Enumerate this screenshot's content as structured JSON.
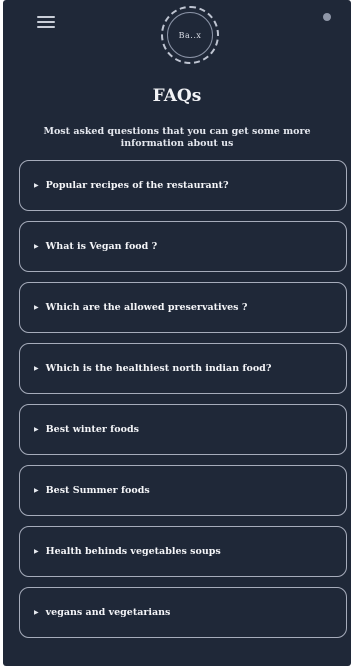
{
  "header": {
    "menu_icon": "hamburger-menu-icon",
    "logo_text": "Ba..x",
    "right_icon": "dot-icon"
  },
  "page": {
    "title": "FAQs",
    "subtitle": "Most asked questions that you can get some more information about us"
  },
  "faqs": [
    {
      "label": "Popular recipes of the restaurant?"
    },
    {
      "label": "What is Vegan food ?"
    },
    {
      "label": "Which are the allowed preservatives ?"
    },
    {
      "label": "Which is the healthiest north indian food?"
    },
    {
      "label": "Best winter foods"
    },
    {
      "label": "Best Summer foods"
    },
    {
      "label": "Health behinds vegetables soups"
    },
    {
      "label": "vegans and vegetarians"
    }
  ],
  "colors": {
    "background": "#1f2838",
    "card_border": "#a6acbb",
    "text": "#f4f5f8"
  }
}
